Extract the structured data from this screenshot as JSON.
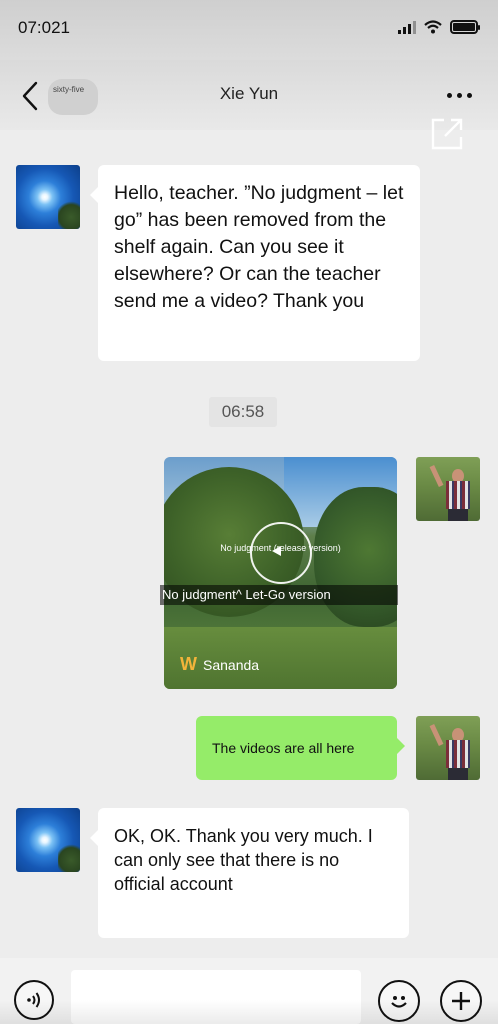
{
  "status_bar": {
    "time": "07:021",
    "icons": [
      "signal-icon",
      "wifi-icon",
      "battery-icon"
    ]
  },
  "nav": {
    "back_icon": "chevron-left-icon",
    "unread_badge": "sixty-five",
    "title": "Xie Yun",
    "more_icon": "more-dots-icon",
    "share_icon": "share-external-icon"
  },
  "messages": [
    {
      "side": "left",
      "type": "text",
      "text": "Hello, teacher. ”No judgment – let go” has been removed from the shelf again. Can you see it elsewhere? Or can the teacher send me a video? Thank you"
    },
    {
      "type": "timestamp",
      "text": "06:58"
    },
    {
      "side": "right",
      "type": "video",
      "small_title": "No judgment (release version)",
      "title": "No judgment^ Let-Go version",
      "brand": "Sananda"
    },
    {
      "side": "right",
      "type": "text",
      "text": "The videos are all here"
    },
    {
      "side": "left",
      "type": "text",
      "text": "OK, OK. Thank you very much. I can only see that there is no official account"
    }
  ],
  "input_bar": {
    "placeholder": "",
    "voice_icon": "voice-icon",
    "emoji_icon": "emoji-icon",
    "plus_icon": "plus-icon"
  },
  "colors": {
    "sent_bubble": "#95ec69",
    "received_bubble": "#ffffff",
    "background": "#ededed"
  }
}
